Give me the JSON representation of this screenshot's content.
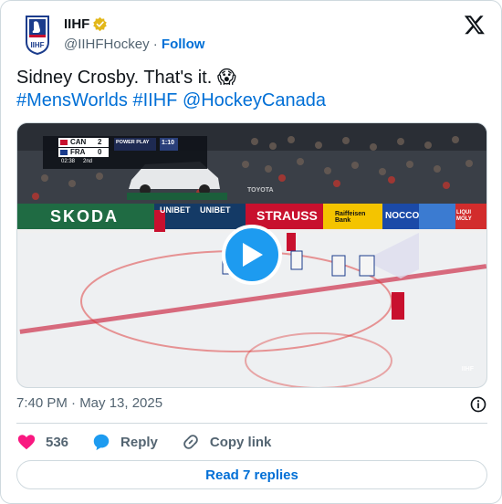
{
  "account": {
    "name": "IIHF",
    "handle": "@IIHFHockey",
    "separator": "·",
    "follow_label": "Follow",
    "avatar_icon": "iihf-logo-icon",
    "verified_icon": "verified-gold-badge-icon"
  },
  "tweet": {
    "text_plain": "Sidney Crosby. That's it. ",
    "emoji": "😱",
    "hashtags": [
      "#MensWorlds",
      "#IIHF",
      "@HockeyCanada"
    ]
  },
  "video": {
    "scorebug": {
      "team1": "CAN",
      "score1": "2",
      "team2": "FRA",
      "score2": "0",
      "period_time": "02:38",
      "period": "2nd",
      "power_play": "POWER PLAY",
      "pp_time": "1:10"
    },
    "boards": [
      "SKODA",
      "UNIBET",
      "UNIBET",
      "STRAUSS",
      "Raiffeisen Bank",
      "NOCCO",
      "LIQUI MOLY",
      "TOYOTA"
    ],
    "watermark": "IIHF",
    "play_icon": "play-icon"
  },
  "meta": {
    "time": "7:40 PM · May 13, 2025",
    "info_icon": "info-icon"
  },
  "actions": {
    "likes": "536",
    "reply_label": "Reply",
    "copy_label": "Copy link",
    "heart_icon": "heart-icon",
    "reply_icon": "reply-bubble-icon",
    "copy_icon": "link-icon"
  },
  "read_replies_label": "Read 7 replies",
  "colors": {
    "accent": "#006fd6",
    "play": "#1d9bf0",
    "heart": "#f91880",
    "muted": "#536471",
    "border": "#cfd9de"
  }
}
